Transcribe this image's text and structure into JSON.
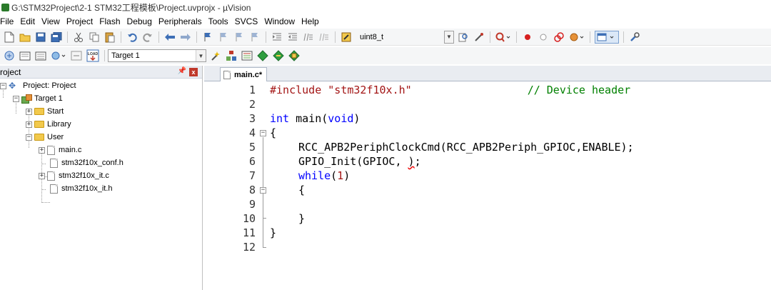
{
  "window": {
    "title": "G:\\STM32Project\\2-1 STM32工程模板\\Project.uvprojx - µVision"
  },
  "menu": [
    "File",
    "Edit",
    "View",
    "Project",
    "Flash",
    "Debug",
    "Peripherals",
    "Tools",
    "SVCS",
    "Window",
    "Help"
  ],
  "toolbar1": {
    "find_combo_value": "uint8_t"
  },
  "toolbar2": {
    "target_combo_value": "Target 1",
    "load_label": "LOAD"
  },
  "project_panel": {
    "title": "roject",
    "tree": {
      "project": "Project: Project",
      "target": "Target 1",
      "groups": {
        "start": "Start",
        "library": "Library",
        "user": "User"
      },
      "user_files": [
        "main.c",
        "stm32f10x_conf.h",
        "stm32f10x_it.c",
        "stm32f10x_it.h"
      ]
    }
  },
  "editor": {
    "active_tab": "main.c*",
    "line_numbers": [
      "1",
      "2",
      "3",
      "4",
      "5",
      "6",
      "7",
      "8",
      "9",
      "10",
      "11",
      "12"
    ],
    "code": {
      "l1_directive": "#include",
      "l1_header": "\"stm32f10x.h\"",
      "l1_comment": "// Device header",
      "l3_int": "int",
      "l3_main": " main(",
      "l3_void": "void",
      "l3_close": ")",
      "l4": "{",
      "l5": "RCC_APB2PeriphClockCmd(RCC_APB2Periph_GPIOC,ENABLE);",
      "l6_call": "GPIO_Init(GPIOC, ",
      "l6_error": ")",
      "l6_end": ";",
      "l7_kw": "while",
      "l7_open": "(",
      "l7_num": "1",
      "l7_close": ")",
      "l8": "{",
      "l10": "}",
      "l11": "}"
    },
    "error_marker": "✕"
  },
  "colors": {
    "keyword": "#0000ff",
    "string": "#a31515",
    "comment": "#008000",
    "error": "#e00000"
  }
}
